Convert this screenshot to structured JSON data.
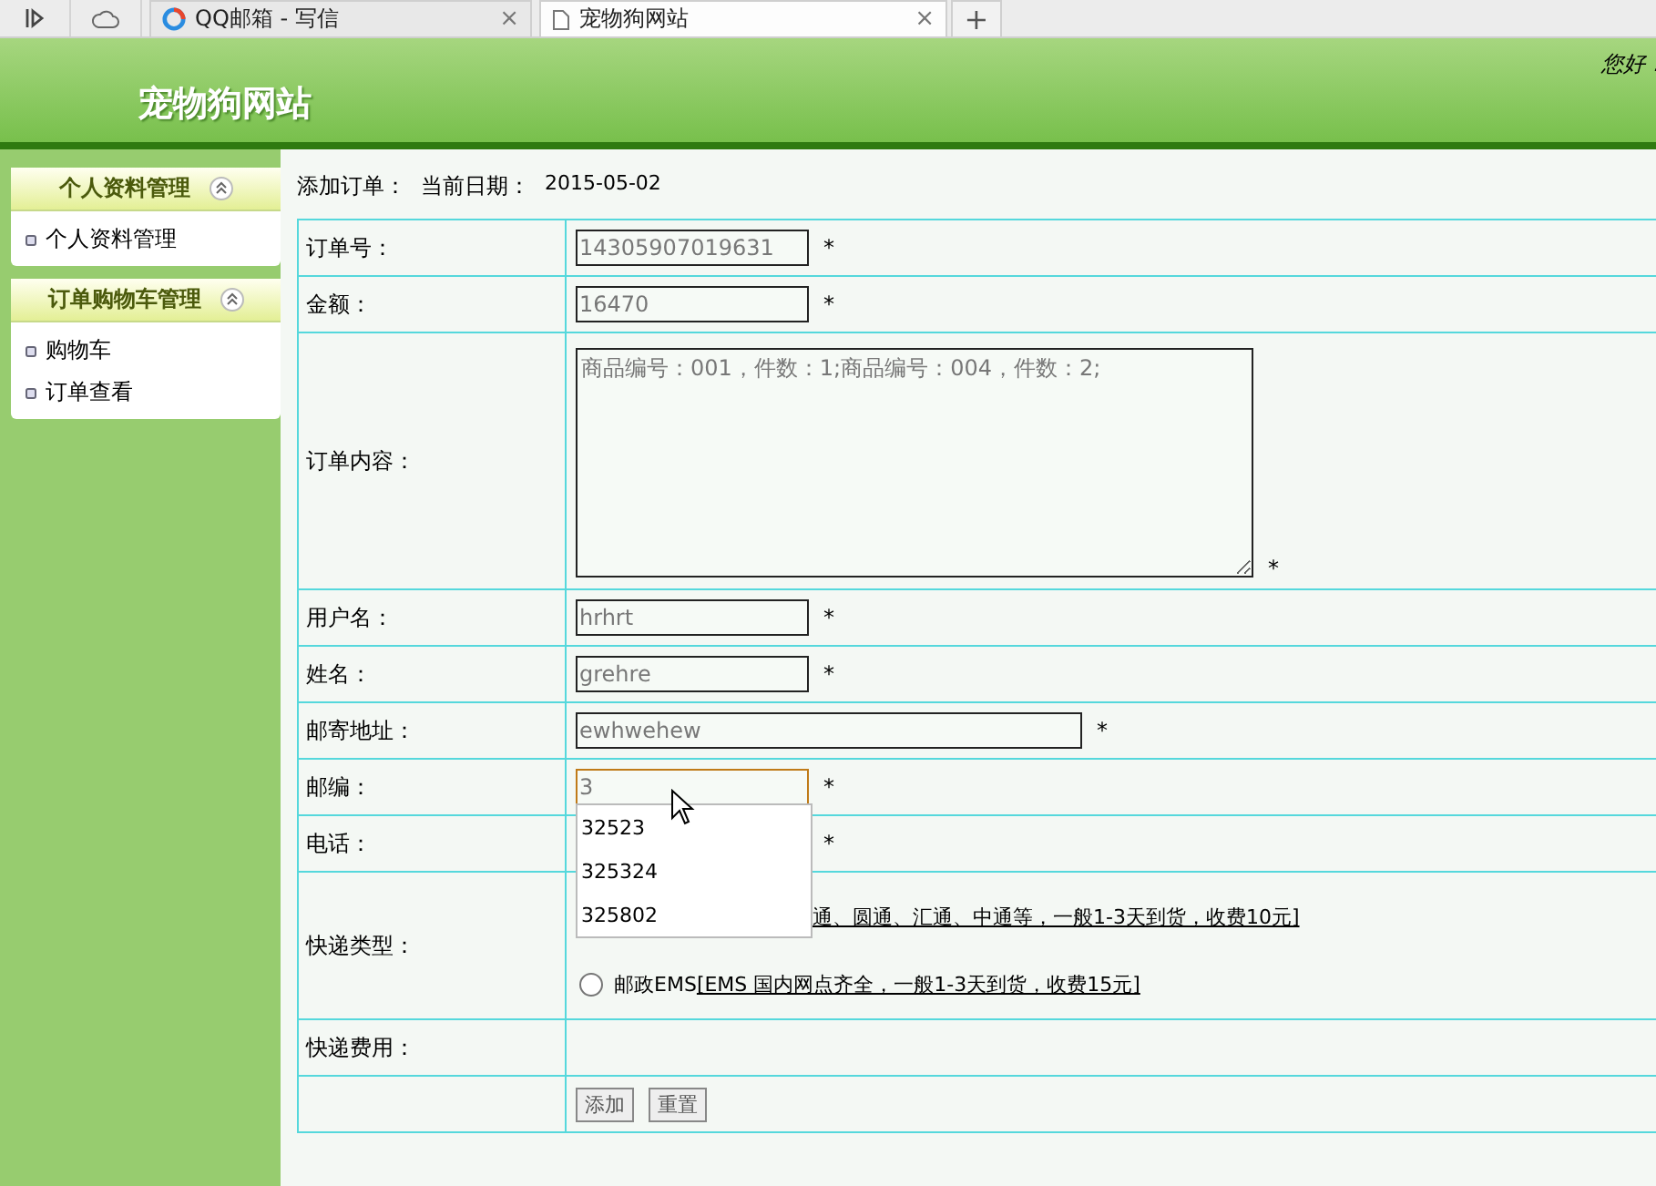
{
  "browser": {
    "tabs": [
      {
        "title": "QQ邮箱 - 写信",
        "selected": false,
        "close": "×"
      },
      {
        "title": "宠物狗网站",
        "selected": true,
        "close": "×"
      }
    ],
    "new_tab": "+"
  },
  "header": {
    "site_title": "宠物狗网站",
    "greeting": "您好："
  },
  "sidebar": {
    "groups": [
      {
        "title": "个人资料管理",
        "expanded": true,
        "items": [
          {
            "label": "个人资料管理"
          }
        ]
      },
      {
        "title": "订单购物车管理",
        "expanded": true,
        "items": [
          {
            "label": "购物车"
          },
          {
            "label": "订单查看"
          }
        ]
      }
    ]
  },
  "form": {
    "heading": "添加订单：",
    "date_label": "当前日期：",
    "date": "2015-05-02",
    "rows": [
      {
        "kind": "input",
        "label": "订单号：",
        "value": "14305907019631",
        "required": "*"
      },
      {
        "kind": "input",
        "label": "金额：",
        "value": "16470",
        "required": "*"
      },
      {
        "kind": "textarea",
        "label": "订单内容：",
        "value": "商品编号：001，件数：1;商品编号：004，件数：2;",
        "required": "*"
      },
      {
        "kind": "input",
        "label": "用户名：",
        "value": "hrhrt",
        "required": "*"
      },
      {
        "kind": "input",
        "label": "姓名：",
        "value": "grehre",
        "required": "*"
      },
      {
        "kind": "wide_input",
        "label": "邮寄地址：",
        "value": "ewhwehew",
        "required": "*"
      },
      {
        "kind": "autocomplete",
        "label": "邮编：",
        "value": "3",
        "focused": true,
        "required": "*",
        "suggestions": [
          "32523",
          "325324",
          "325802"
        ]
      },
      {
        "kind": "covered",
        "label": "电话：",
        "required": "*"
      },
      {
        "kind": "radios",
        "label": "快递类型：",
        "options": [
          {
            "kind": "partial",
            "detail": "通、圆通、汇通、中通等，一般1-3天到货，收费10元]"
          },
          {
            "kind": "radio",
            "name": "邮政EMS",
            "detail": "[EMS 国内网点齐全，一般1-3天到货，收费15元]",
            "selected": false
          }
        ]
      },
      {
        "kind": "label_only",
        "label": "快递费用："
      },
      {
        "kind": "buttons",
        "buttons": [
          "添加",
          "重置"
        ]
      }
    ]
  }
}
